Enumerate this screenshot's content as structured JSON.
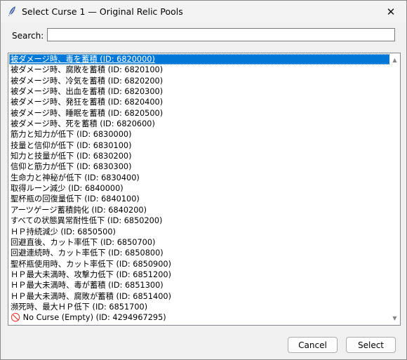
{
  "window": {
    "title": "Select Curse 1 — Original Relic Pools",
    "close_glyph": "✕"
  },
  "search": {
    "label": "Search:",
    "value": ""
  },
  "list": {
    "selected_index": 0,
    "items": [
      "被ダメージ時、毒を蓄積 (ID: 6820000)",
      "被ダメージ時、腐敗を蓄積 (ID: 6820100)",
      "被ダメージ時、冷気を蓄積 (ID: 6820200)",
      "被ダメージ時、出血を蓄積 (ID: 6820300)",
      "被ダメージ時、発狂を蓄積 (ID: 6820400)",
      "被ダメージ時、睡眠を蓄積 (ID: 6820500)",
      "被ダメージ時、死を蓄積 (ID: 6820600)",
      "筋力と知力が低下 (ID: 6830000)",
      "技量と信仰が低下 (ID: 6830100)",
      "知力と技量が低下 (ID: 6830200)",
      "信仰と筋力が低下 (ID: 6830300)",
      "生命力と神秘が低下 (ID: 6830400)",
      "取得ルーン減少 (ID: 6840000)",
      "聖杯瓶の回復量低下 (ID: 6840100)",
      "アーツゲージ蓄積鈍化 (ID: 6840200)",
      "すべての状態異常耐性低下 (ID: 6850200)",
      "ＨＰ持続減少 (ID: 6850500)",
      "回避直後、カット率低下 (ID: 6850700)",
      "回避連続時、カット率低下 (ID: 6850800)",
      "聖杯瓶使用時、カット率低下 (ID: 6850900)",
      "ＨＰ最大未満時、攻撃力低下 (ID: 6851200)",
      "ＨＰ最大未満時、毒が蓄積 (ID: 6851300)",
      "ＨＰ最大未満時、腐敗が蓄積 (ID: 6851400)",
      "瀕死時、最大ＨＰ低下 (ID: 6851700)",
      "🚫 No Curse (Empty) (ID: 4294967295)"
    ]
  },
  "scrollbar": {
    "up_glyph": "▲",
    "down_glyph": "▼"
  },
  "buttons": {
    "cancel": "Cancel",
    "select": "Select"
  },
  "colors": {
    "selection": "#0078d7",
    "window_bg": "#f0f0f0"
  }
}
